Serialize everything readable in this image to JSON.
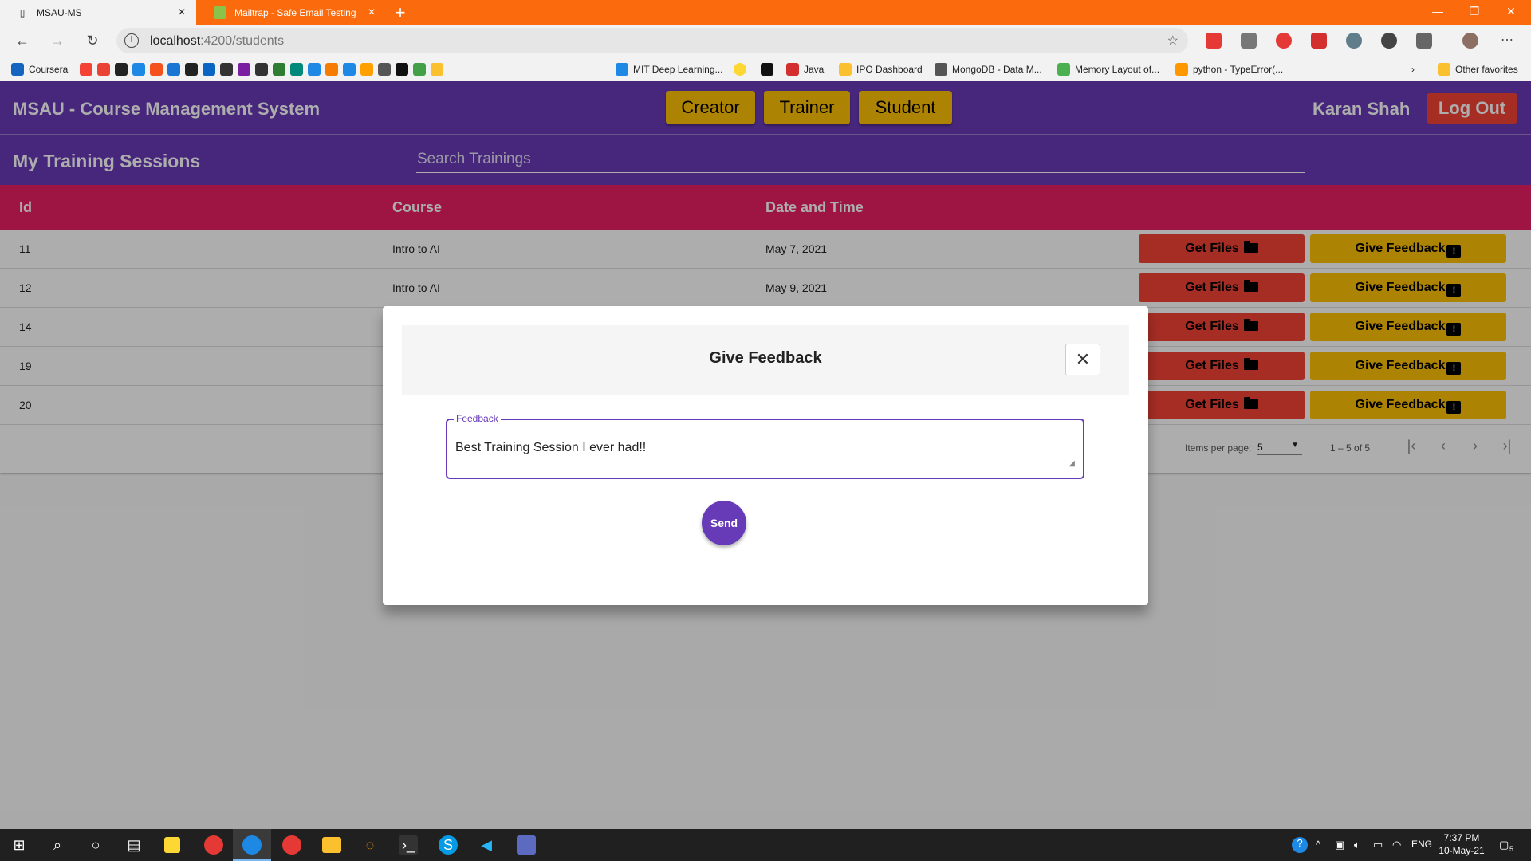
{
  "browser": {
    "tabs": [
      {
        "title": "MSAU-MS"
      },
      {
        "title": "Mailtrap - Safe Email Testing"
      }
    ],
    "url_host": "localhost",
    "url_path": ":4200/students",
    "bookmarks": [
      "Coursera",
      "MIT Deep Learning...",
      "Java",
      "IPO Dashboard",
      "MongoDB - Data M...",
      "Memory Layout of...",
      "python - TypeError(..."
    ],
    "other_favorites": "Other favorites"
  },
  "header": {
    "app_title": "MSAU - Course Management System",
    "roles": [
      "Creator",
      "Trainer",
      "Student"
    ],
    "user_name": "Karan Shah",
    "logout_label": "Log Out"
  },
  "subheader": {
    "page_title": "My Training Sessions",
    "search_placeholder": "Search Trainings"
  },
  "table": {
    "columns": [
      "Id",
      "Course",
      "Date and Time"
    ],
    "rows": [
      {
        "id": "11",
        "course": "Intro to AI",
        "date": "May 7, 2021"
      },
      {
        "id": "12",
        "course": "Intro to AI",
        "date": "May 9, 2021"
      },
      {
        "id": "14",
        "course": "",
        "date": ""
      },
      {
        "id": "19",
        "course": "",
        "date": ""
      },
      {
        "id": "20",
        "course": "",
        "date": ""
      }
    ],
    "get_files_label": "Get Files",
    "feedback_label": "Give Feedback"
  },
  "paginator": {
    "items_per_page_label": "Items per page:",
    "items_per_page_value": "5",
    "range_label": "1 – 5 of 5"
  },
  "modal": {
    "title": "Give Feedback",
    "field_label": "Feedback",
    "field_value": "Best Training Session I ever had!!",
    "send_label": "Send"
  },
  "taskbar": {
    "language": "ENG",
    "time": "7:37 PM",
    "date": "10-May-21",
    "notification_count": "5"
  },
  "colors": {
    "primary": "#673ab7",
    "accent_pink": "#e91e63",
    "warn_red": "#f44336",
    "amber": "#ffc107",
    "browser_orange": "#fb6a0c"
  }
}
